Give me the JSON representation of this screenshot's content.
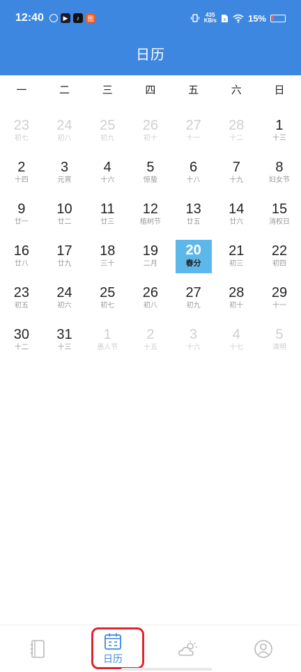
{
  "status_bar": {
    "time": "12:40",
    "net_speed_value": "435",
    "net_speed_unit": "KB/s",
    "battery": "15%"
  },
  "header": {
    "title": "日历"
  },
  "weekdays": [
    "一",
    "二",
    "三",
    "四",
    "五",
    "六",
    "日"
  ],
  "days": [
    {
      "num": "23",
      "sub": "初七",
      "muted": true
    },
    {
      "num": "24",
      "sub": "初八",
      "muted": true
    },
    {
      "num": "25",
      "sub": "初九",
      "muted": true
    },
    {
      "num": "26",
      "sub": "初十",
      "muted": true
    },
    {
      "num": "27",
      "sub": "十一",
      "muted": true
    },
    {
      "num": "28",
      "sub": "十二",
      "muted": true
    },
    {
      "num": "1",
      "sub": "十三",
      "muted": false
    },
    {
      "num": "2",
      "sub": "十四",
      "muted": false
    },
    {
      "num": "3",
      "sub": "元宵",
      "muted": false
    },
    {
      "num": "4",
      "sub": "十六",
      "muted": false
    },
    {
      "num": "5",
      "sub": "惊蛰",
      "muted": false
    },
    {
      "num": "6",
      "sub": "十八",
      "muted": false
    },
    {
      "num": "7",
      "sub": "十九",
      "muted": false
    },
    {
      "num": "8",
      "sub": "妇女节",
      "muted": false
    },
    {
      "num": "9",
      "sub": "廿一",
      "muted": false
    },
    {
      "num": "10",
      "sub": "廿二",
      "muted": false
    },
    {
      "num": "11",
      "sub": "廿三",
      "muted": false
    },
    {
      "num": "12",
      "sub": "植树节",
      "muted": false
    },
    {
      "num": "13",
      "sub": "廿五",
      "muted": false
    },
    {
      "num": "14",
      "sub": "廿六",
      "muted": false
    },
    {
      "num": "15",
      "sub": "消权日",
      "muted": false
    },
    {
      "num": "16",
      "sub": "廿八",
      "muted": false
    },
    {
      "num": "17",
      "sub": "廿九",
      "muted": false
    },
    {
      "num": "18",
      "sub": "三十",
      "muted": false
    },
    {
      "num": "19",
      "sub": "二月",
      "muted": false
    },
    {
      "num": "20",
      "sub": "春分",
      "muted": false,
      "today": true
    },
    {
      "num": "21",
      "sub": "初三",
      "muted": false
    },
    {
      "num": "22",
      "sub": "初四",
      "muted": false
    },
    {
      "num": "23",
      "sub": "初五",
      "muted": false
    },
    {
      "num": "24",
      "sub": "初六",
      "muted": false
    },
    {
      "num": "25",
      "sub": "初七",
      "muted": false
    },
    {
      "num": "26",
      "sub": "初八",
      "muted": false
    },
    {
      "num": "27",
      "sub": "初九",
      "muted": false
    },
    {
      "num": "28",
      "sub": "初十",
      "muted": false
    },
    {
      "num": "29",
      "sub": "十一",
      "muted": false
    },
    {
      "num": "30",
      "sub": "十二",
      "muted": false
    },
    {
      "num": "31",
      "sub": "十三",
      "muted": false
    },
    {
      "num": "1",
      "sub": "愚人节",
      "muted": true
    },
    {
      "num": "2",
      "sub": "十五",
      "muted": true
    },
    {
      "num": "3",
      "sub": "十六",
      "muted": true
    },
    {
      "num": "4",
      "sub": "十七",
      "muted": true
    },
    {
      "num": "5",
      "sub": "清明",
      "muted": true
    }
  ],
  "bottom_nav": {
    "items": [
      {
        "icon": "notebook-icon",
        "label": ""
      },
      {
        "icon": "calendar-icon",
        "label": "日历"
      },
      {
        "icon": "weather-icon",
        "label": ""
      },
      {
        "icon": "profile-icon",
        "label": ""
      }
    ]
  },
  "colors": {
    "header": "#3d87e0",
    "today": "#5db8ea",
    "highlight": "#e0242c"
  }
}
